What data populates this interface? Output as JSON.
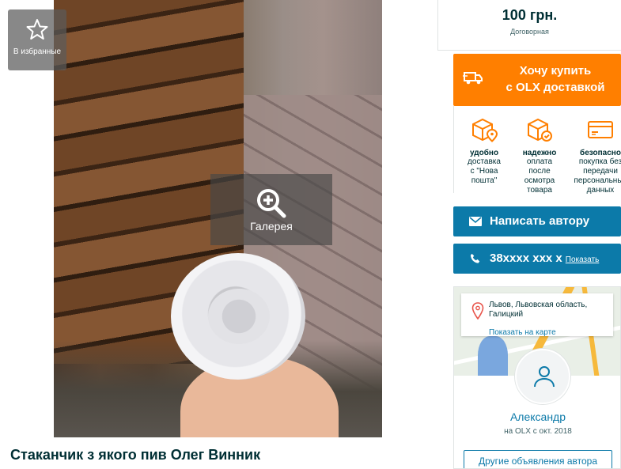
{
  "favorites": {
    "label": "В избранные",
    "icon": "star-icon"
  },
  "gallery": {
    "label": "Галерея",
    "icon": "zoom-in-icon"
  },
  "ad": {
    "title": "Стаканчик з якого пив Олег Винник"
  },
  "price": {
    "value": "100 грн.",
    "negotiable": "Договорная"
  },
  "buy": {
    "label": "Хочу купить\nс OLX доставкой",
    "icon": "truck-icon",
    "color": "#ff7f00"
  },
  "benefits": [
    {
      "icon": "box-location-icon",
      "title": "удобно",
      "desc": "доставка\nс \"Нова\nпошта\""
    },
    {
      "icon": "box-check-icon",
      "title": "надежно",
      "desc": "оплата\nпосле\nосмотра\nтовара"
    },
    {
      "icon": "card-icon",
      "title": "безопасно",
      "desc": "покупка без\nпередачи\nперсональных\nданных"
    }
  ],
  "message": {
    "label": "Написать автору",
    "icon": "envelope-icon"
  },
  "phone": {
    "number": "38xxxx xxx x",
    "show": "Показать",
    "icon": "phone-icon"
  },
  "location": {
    "address": "Львов, Львовская область,\nГалицкий",
    "map_link": "Показать на карте",
    "icon": "map-pin-icon"
  },
  "author": {
    "name": "Александр",
    "since": "на OLX с окт. 2018",
    "other_ads": "Другие объявления автора",
    "avatar_icon": "user-icon"
  },
  "colors": {
    "accent": "#0c7aa9",
    "orange": "#ff7f00",
    "text": "#002f34"
  }
}
